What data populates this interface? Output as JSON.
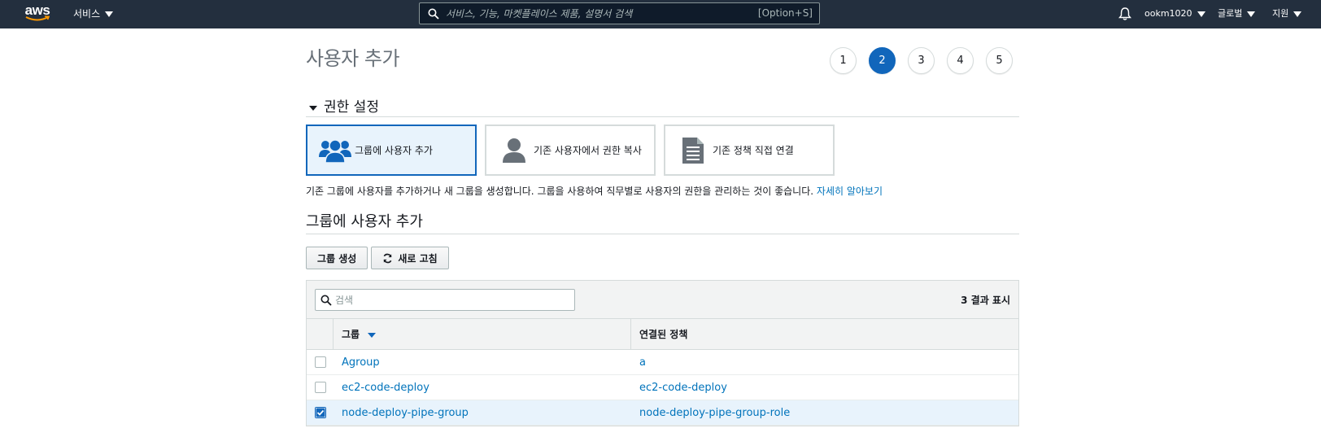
{
  "topnav": {
    "logo": "aws",
    "services_label": "서비스",
    "search_placeholder": "서비스, 기능, 마켓플레이스 제품, 설명서 검색",
    "search_shortcut": "[Option+S]",
    "account_label": "ookm1020",
    "region_label": "글로벌",
    "support_label": "지원"
  },
  "page": {
    "title": "사용자 추가",
    "steps": [
      "1",
      "2",
      "3",
      "4",
      "5"
    ],
    "active_step": "2"
  },
  "permissions": {
    "section_title": "권한 설정",
    "options": [
      {
        "label": "그룹에 사용자 추가",
        "icon": "users-group-icon",
        "selected": true
      },
      {
        "label": "기존 사용자에서 권한 복사",
        "icon": "user-icon",
        "selected": false
      },
      {
        "label": "기존 정책 직접 연결",
        "icon": "document-icon",
        "selected": false
      }
    ],
    "description": "기존 그룹에 사용자를 추가하거나 새 그룹을 생성합니다. 그룹을 사용하여 직무별로 사용자의 권한을 관리하는 것이 좋습니다.",
    "learn_more": "자세히 알아보기"
  },
  "groups": {
    "title": "그룹에 사용자 추가",
    "create_button": "그룹 생성",
    "refresh_button": "새로 고침",
    "filter_placeholder": "검색",
    "result_count": "3 결과 표시",
    "columns": {
      "group": "그룹",
      "policy": "연결된 정책"
    },
    "rows": [
      {
        "group": "Agroup",
        "policy": "a",
        "checked": false
      },
      {
        "group": "ec2-code-deploy",
        "policy": "ec2-code-deploy",
        "checked": false
      },
      {
        "group": "node-deploy-pipe-group",
        "policy": "node-deploy-pipe-group-role",
        "checked": true
      }
    ]
  },
  "colors": {
    "nav_bg": "#232f3e",
    "accent": "#1166bb",
    "link": "#0073bb",
    "selected_bg": "#e8f3fc",
    "logo_smile": "#ff9900"
  }
}
